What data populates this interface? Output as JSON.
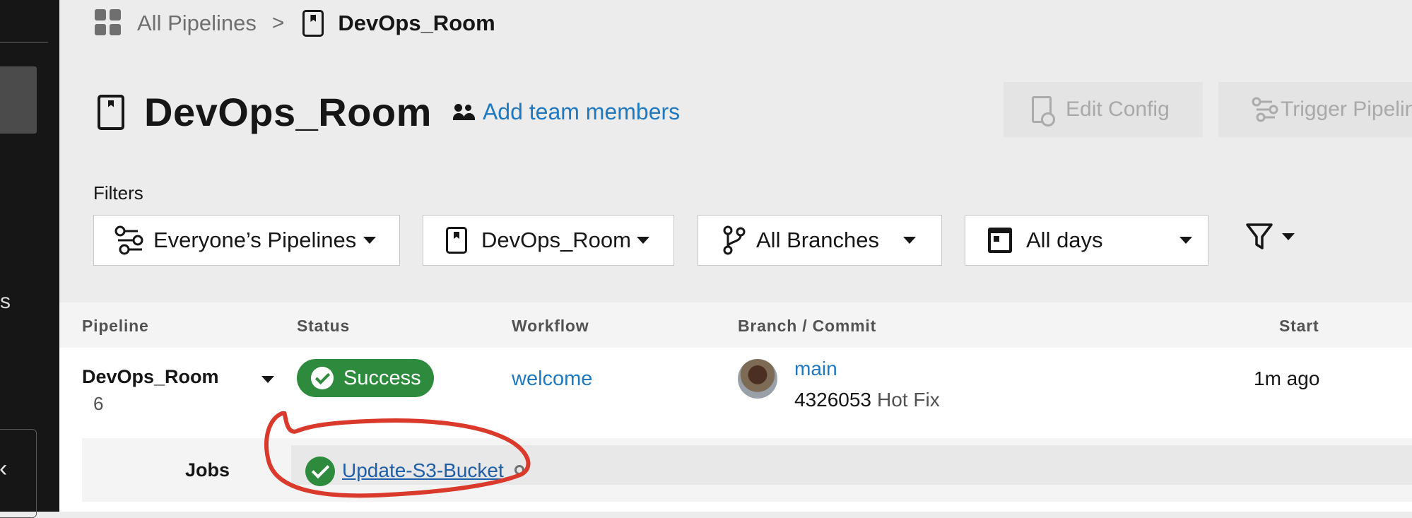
{
  "breadcrumb": {
    "root": "All Pipelines",
    "separator": ">",
    "current": "DevOps_Room"
  },
  "sidebar": {
    "partial_label": "s"
  },
  "header": {
    "title": "DevOps_Room",
    "add_team_members": "Add team members",
    "edit_config": "Edit Config",
    "trigger_pipeline": "Trigger Pipelin"
  },
  "filters": {
    "label": "Filters",
    "pipelines": "Everyone’s Pipelines",
    "project": "DevOps_Room",
    "branches": "All Branches",
    "days": "All days"
  },
  "table": {
    "columns": [
      "Pipeline",
      "Status",
      "Workflow",
      "Branch / Commit",
      "Start"
    ],
    "row": {
      "pipeline_name": "DevOps_Room",
      "pipeline_number": "6",
      "status": "Success",
      "workflow": "welcome",
      "branch": "main",
      "commit_hash": "4326053",
      "commit_message": "Hot Fix",
      "start": "1m ago"
    },
    "jobs": {
      "label": "Jobs",
      "job_name": "Update-S3-Bucket"
    }
  },
  "colors": {
    "accent": "#1f79c1",
    "success": "#2e8a3c",
    "annotation": "#d93a2b",
    "sidebar": "#161616"
  }
}
